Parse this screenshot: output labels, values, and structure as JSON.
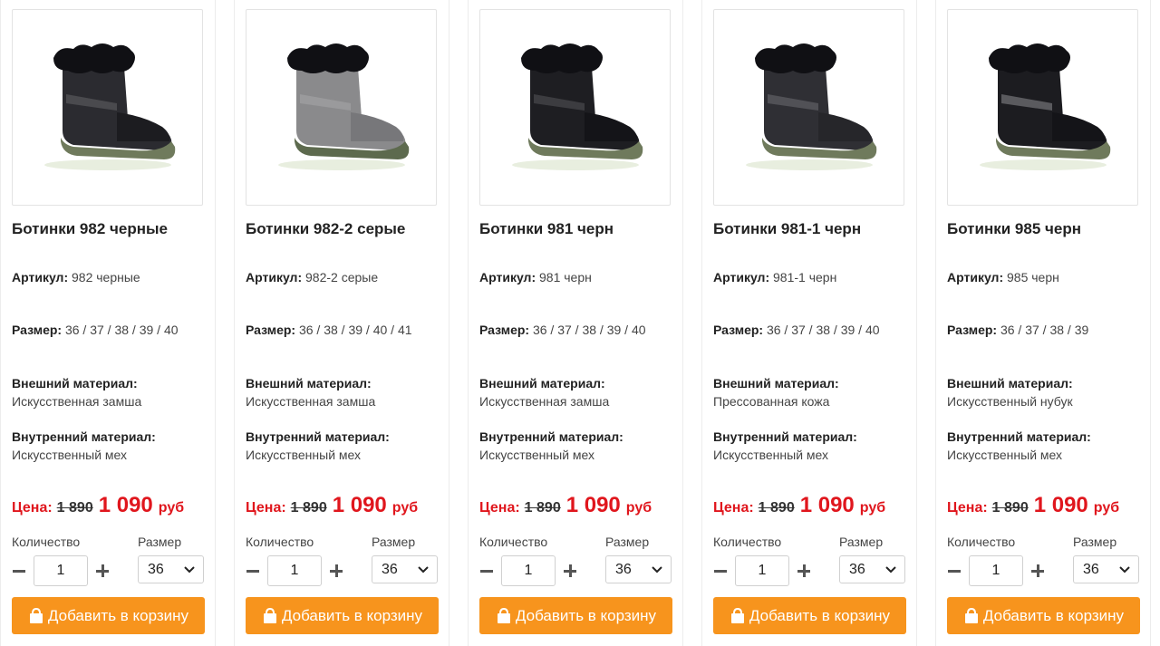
{
  "labels": {
    "article": "Артикул:",
    "size": "Размер:",
    "outer_material": "Внешний материал:",
    "inner_material": "Внутренний материал:",
    "price": "Цена:",
    "currency": "руб",
    "quantity": "Количество",
    "size_select": "Размер",
    "add_to_cart": "Добавить в корзину"
  },
  "colors": {
    "accent_button": "#f7941d",
    "price_red": "#e0161d"
  },
  "products": [
    {
      "title": "Ботинки 982 черные",
      "article": "982 черные",
      "sizes": [
        "36",
        "37",
        "38",
        "39",
        "40"
      ],
      "outer": "Искусственная замша",
      "inner": "Искусственный мех",
      "old_price": "1 890",
      "new_price": "1 090",
      "qty": "1",
      "selected_size": "36",
      "image_icon": "black-suede-boot"
    },
    {
      "title": "Ботинки 982-2 серые",
      "article": "982-2 серые",
      "sizes": [
        "36",
        "38",
        "39",
        "40",
        "41"
      ],
      "outer": "Искусственная замша",
      "inner": "Искусственный мех",
      "old_price": "1 890",
      "new_price": "1 090",
      "qty": "1",
      "selected_size": "36",
      "image_icon": "grey-suede-boot"
    },
    {
      "title": "Ботинки 981 черн",
      "article": "981 черн",
      "sizes": [
        "36",
        "37",
        "38",
        "39",
        "40"
      ],
      "outer": "Искусственная замша",
      "inner": "Искусственный мех",
      "old_price": "1 890",
      "new_price": "1 090",
      "qty": "1",
      "selected_size": "36",
      "image_icon": "black-suede-boot-strap"
    },
    {
      "title": "Ботинки 981-1 черн",
      "article": "981-1 черн",
      "sizes": [
        "36",
        "37",
        "38",
        "39",
        "40"
      ],
      "outer": "Прессованная кожа",
      "inner": "Искусственный мех",
      "old_price": "1 890",
      "new_price": "1 090",
      "qty": "1",
      "selected_size": "36",
      "image_icon": "black-leather-boot"
    },
    {
      "title": "Ботинки 985 черн",
      "article": "985 черн",
      "sizes": [
        "36",
        "37",
        "38",
        "39"
      ],
      "outer": "Искусственный нубук",
      "inner": "Искусственный мех",
      "old_price": "1 890",
      "new_price": "1 090",
      "qty": "1",
      "selected_size": "36",
      "image_icon": "black-nubuck-boot-straps"
    }
  ]
}
